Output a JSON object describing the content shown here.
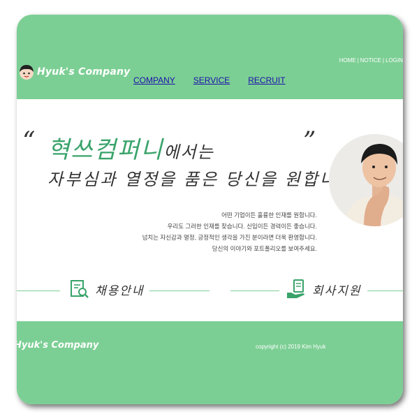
{
  "header": {
    "logo_text": "Hyuk's Company",
    "top_links": [
      "HOME",
      "NOTICE",
      "LOGIN"
    ],
    "nav": [
      "COMPANY",
      "SERVICE",
      "RECRUIT"
    ]
  },
  "hero": {
    "quote_open": "“",
    "quote_close": "”",
    "headline_green": "혁쓰컴퍼니",
    "headline_dark": "에서는",
    "headline_line2": "자부심과 열정을 품은 당신을 원합니다.",
    "description": [
      "어떤 기업이든 훌륭한 인재를 원합니다.",
      "우리도 그러한 인재를 찾습니다. 신입이든 경력이든 좋습니다.",
      "넘치는 자신감과 열정, 긍정적인 생각을 가진 분이라면 더욱 환영합니다.",
      "당신의 이야기와 포트폴리오를 보여주세요."
    ],
    "link_recruit": "채용안내",
    "link_apply": "회사지원"
  },
  "footer": {
    "logo_text": "Hyuk's Company",
    "copyright": "copyright (c) 2019 Kim Hyuk"
  },
  "colors": {
    "brand_green": "#7ccf94",
    "headline_green": "#39a36a"
  }
}
